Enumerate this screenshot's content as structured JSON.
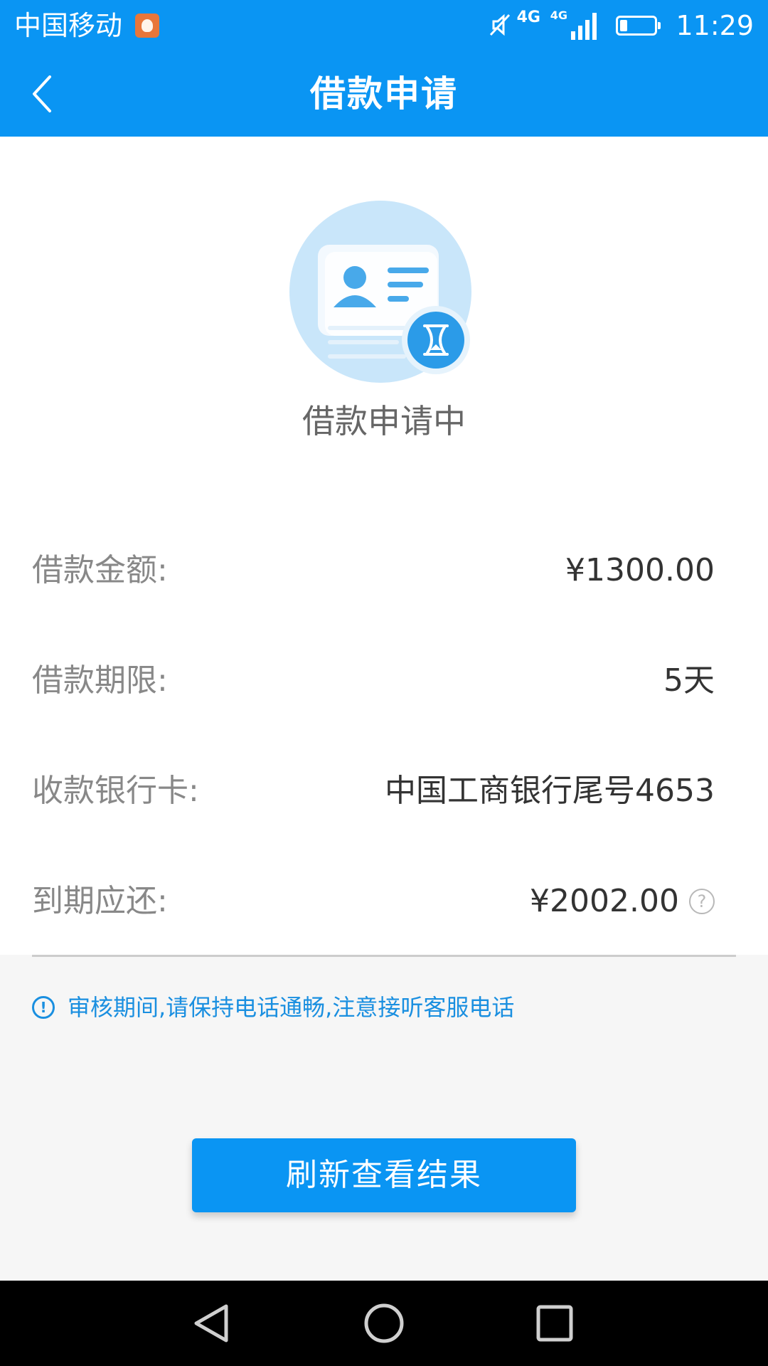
{
  "status_bar": {
    "carrier": "中国移动",
    "network_1": "4G",
    "network_2": "4G",
    "time": "11:29"
  },
  "header": {
    "title": "借款申请"
  },
  "status": {
    "title": "借款申请中"
  },
  "details": [
    {
      "label": "借款金额:",
      "value": "¥1300.00"
    },
    {
      "label": "借款期限:",
      "value": "5天"
    },
    {
      "label": "收款银行卡:",
      "value": "中国工商银行尾号4653"
    },
    {
      "label": "到期应还:",
      "value": "¥2002.00"
    }
  ],
  "notice": {
    "text": "审核期间,请保持电话通畅,注意接听客服电话"
  },
  "actions": {
    "refresh_label": "刷新查看结果"
  },
  "colors": {
    "primary": "#0a95f3",
    "notice": "#1a8fe0",
    "label": "#888888",
    "value": "#333333"
  }
}
